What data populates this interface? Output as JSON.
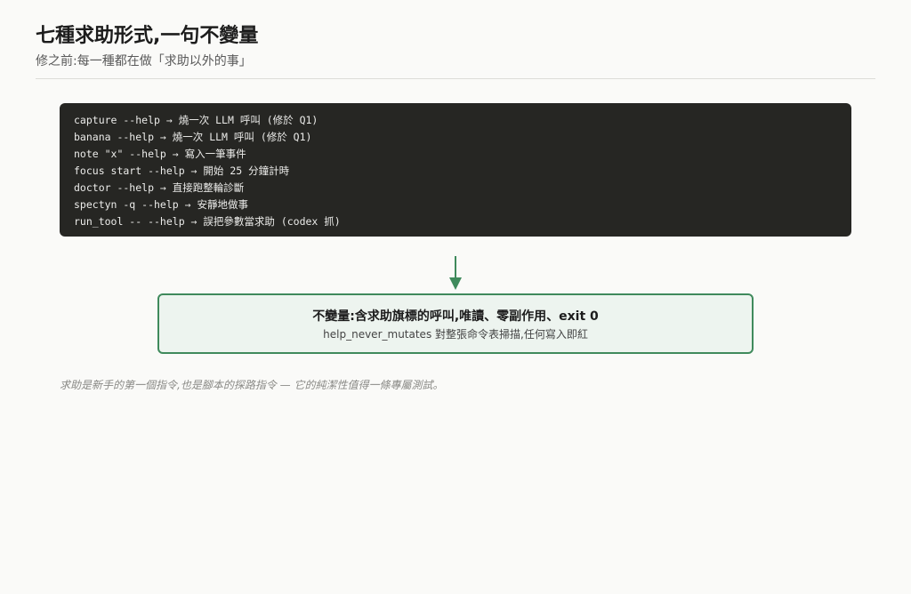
{
  "header": {
    "title": "七種求助形式,一句不變量",
    "subtitle": "修之前:每一種都在做「求助以外的事」"
  },
  "code_lines": [
    "capture --help → 燒一次 LLM 呼叫 (修於 Q1)",
    "banana --help → 燒一次 LLM 呼叫 (修於 Q1)",
    "note \"x\" --help → 寫入一筆事件",
    "focus start --help → 開始 25 分鐘計時",
    "doctor --help → 直接跑整輪診斷",
    "spectyn -q --help → 安靜地做事",
    "run_tool -- --help → 誤把參數當求助 (codex 抓)"
  ],
  "invariant": {
    "title": "不變量:含求助旗標的呼叫,唯讀、零副作用、exit 0",
    "detail": "help_never_mutates 對整張命令表掃描,任何寫入即紅"
  },
  "footnote": "求助是新手的第一個指令,也是腳本的探路指令 — 它的純潔性值得一條專屬測試。",
  "colors": {
    "accent": "#3f8a5c",
    "code_bg": "#262623",
    "invariant_bg": "#edf4ef"
  },
  "icons": {
    "flow_arrow": "arrow-down-icon"
  }
}
